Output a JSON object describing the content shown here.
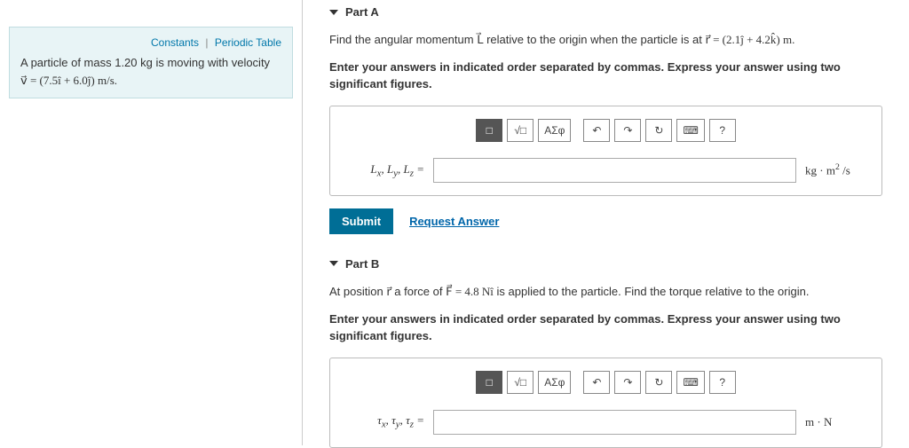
{
  "links": {
    "constants": "Constants",
    "periodic": "Periodic Table"
  },
  "problem": {
    "line1_a": "A particle of mass 1.20 kg is moving with velocity",
    "line1_b": "v⃗ = (7.5î + 6.0ĵ) m/s."
  },
  "partA": {
    "title": "Part A",
    "question_a": "Find the angular momentum ",
    "question_b": " relative to the origin when the particle is at ",
    "question_c": "r⃗ = (2.1ĵ + 4.2k̂) m.",
    "instruction": "Enter your answers in indicated order separated by commas. Express your answer using two significant figures.",
    "var_label": "Lₓ, Lᵧ, L_z =",
    "unit": "kg · m² /s",
    "submit": "Submit",
    "request": "Request Answer",
    "vec_L": "L⃗"
  },
  "partB": {
    "title": "Part B",
    "question_a": "At position r⃗ a force of ",
    "question_b": "F⃗ = 4.8 Nî",
    "question_c": " is applied to the particle. Find the torque relative to the origin.",
    "instruction": "Enter your answers in indicated order separated by commas. Express your answer using two significant figures.",
    "var_label": "τₓ, τᵧ, τ_z =",
    "unit": "m · N"
  },
  "toolbar": {
    "mode": "□",
    "template": "√□",
    "greek": "ΑΣφ",
    "undo": "↶",
    "redo": "↷",
    "reset": "↻",
    "keyboard": "⌨",
    "help": "?"
  }
}
